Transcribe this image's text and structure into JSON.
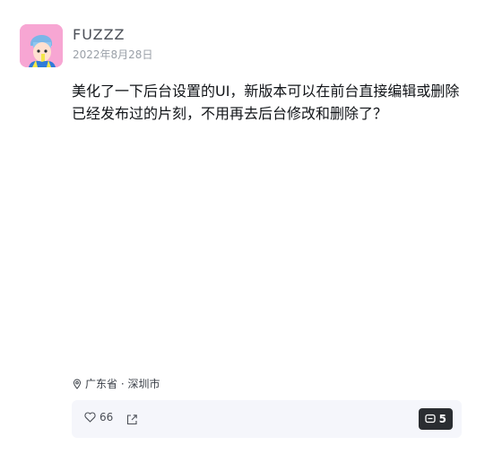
{
  "author": {
    "name": "FUZZZ",
    "date": "2022年8月28日"
  },
  "post": {
    "content": "美化了一下后台设置的UI，新版本可以在前台直接编辑或删除已经发布过的片刻，不用再去后台修改和删除了？"
  },
  "location": {
    "text": "广东省 · 深圳市"
  },
  "actions": {
    "like_count": "66",
    "comment_count": "5"
  }
}
